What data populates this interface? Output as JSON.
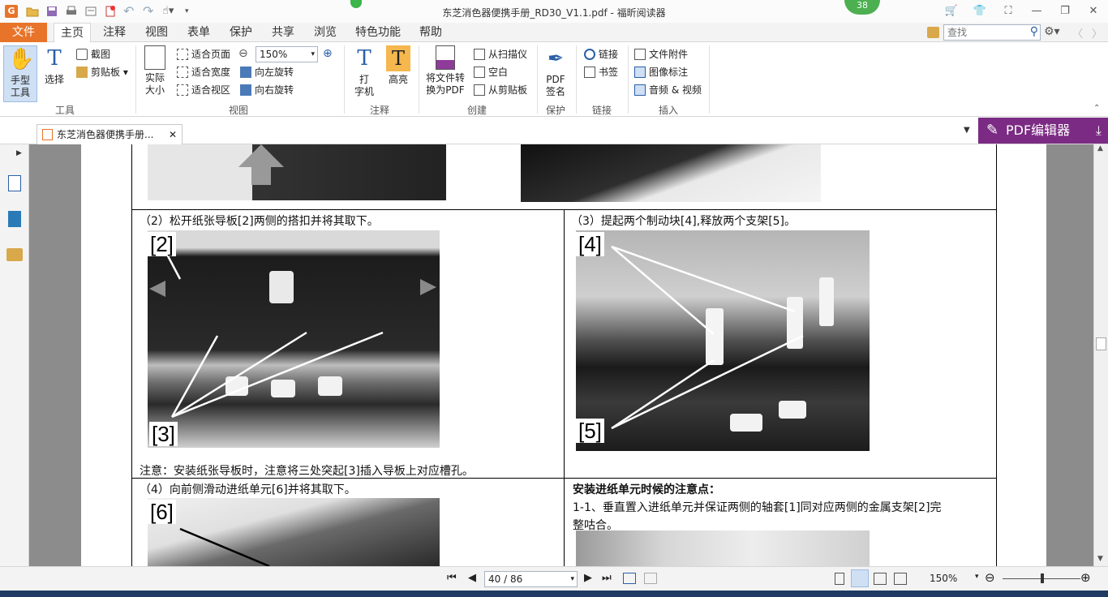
{
  "window": {
    "title": "东芝消色器便携手册_RD30_V1.1.pdf - 福昕阅读器",
    "badge_count": "38"
  },
  "menu_tabs": [
    "文件",
    "主页",
    "注释",
    "视图",
    "表单",
    "保护",
    "共享",
    "浏览",
    "特色功能",
    "帮助"
  ],
  "search": {
    "placeholder": "查找"
  },
  "ribbon": {
    "tools": {
      "hand_label": "手型\n工具",
      "select_label": "选择",
      "screenshot_label": "截图",
      "clipboard_label": "剪贴板",
      "group_label": "工具"
    },
    "view": {
      "actual_size_label": "实际\n大小",
      "fit_page_label": "适合页面",
      "fit_width_label": "适合宽度",
      "fit_visible_label": "适合视区",
      "zoom_value": "150%",
      "rotate_left_label": "向左旋转",
      "rotate_right_label": "向右旋转",
      "group_label": "视图"
    },
    "comment": {
      "typewriter_label": "打\n字机",
      "highlight_label": "高亮",
      "group_label": "注释"
    },
    "create": {
      "convert_label": "将文件转\n换为PDF",
      "from_scanner_label": "从扫描仪",
      "blank_label": "空白",
      "from_clipboard_label": "从剪贴板",
      "group_label": "创建"
    },
    "protect": {
      "sign_label": "PDF\n签名",
      "group_label": "保护"
    },
    "links": {
      "link_label": "链接",
      "bookmark_label": "书签",
      "group_label": "链接"
    },
    "insert": {
      "attachment_label": "文件附件",
      "image_label": "图像标注",
      "media_label": "音频 & 视频",
      "group_label": "插入"
    }
  },
  "doc_tab": {
    "title": "东芝消色器便携手册..."
  },
  "pdf_editor_button": "PDF编辑器",
  "page_content": {
    "step2": "（2）松开纸张导板[2]两侧的搭扣并将其取下。",
    "step3": "（3）提起两个制动块[4],释放两个支架[5]。",
    "step2_callout_a": "[2]",
    "step2_callout_b": "[3]",
    "step3_callout_a": "[4]",
    "step3_callout_b": "[5]",
    "note": "注意：安装纸张导板时，注意将三处突起[3]插入导板上对应槽孔。",
    "step4": "（4）向前侧滑动进纸单元[6]并将其取下。",
    "step4_callout": "[6]",
    "install_title": "安装进纸单元时候的注意点：",
    "install_line1": "1-1、垂直置入进纸单元并保证两侧的轴套[1]同对应两侧的金属支架[2]完",
    "install_line2": "整咕合。"
  },
  "statusbar": {
    "page_indicator": "40 / 86",
    "zoom": "150%"
  }
}
